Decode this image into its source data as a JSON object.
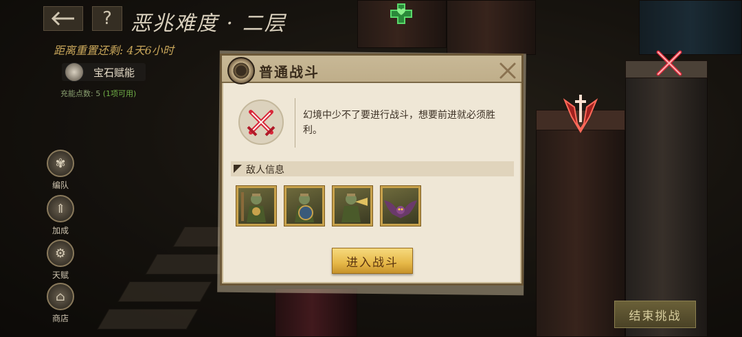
{
  "header": {
    "back_icon": "arrow-left-icon",
    "help_label": "?",
    "title": "恶兆难度 · 二层",
    "reset_text": "距离重置还剩: 4天6小时"
  },
  "gem": {
    "label": "宝石赋能",
    "charge_prefix": "充能点数:  5",
    "charge_available": "(1项可用)"
  },
  "side_menu": [
    {
      "label": "编队",
      "icon": "tree-icon"
    },
    {
      "label": "加成",
      "icon": "arrow-up-icon"
    },
    {
      "label": "天赋",
      "icon": "gear-icon"
    },
    {
      "label": "商店",
      "icon": "shop-icon"
    }
  ],
  "end_button": "结束挑战",
  "dialog": {
    "title": "普通战斗",
    "close_icon": "close-icon",
    "battle_icon": "crossed-swords-icon",
    "description": "幻境中少不了要进行战斗，想要前进就必须胜利。",
    "enemy_section_title": "敌人信息",
    "enemies": [
      {
        "icon": "goblin-warrior-icon"
      },
      {
        "icon": "goblin-shield-icon"
      },
      {
        "icon": "goblin-trumpeter-icon"
      },
      {
        "icon": "bat-icon"
      }
    ],
    "enter_button": "进入战斗"
  },
  "colors": {
    "accent_gold": "#e6b848",
    "battle_red": "#d8283a",
    "dialog_bg": "#efe7d6"
  }
}
